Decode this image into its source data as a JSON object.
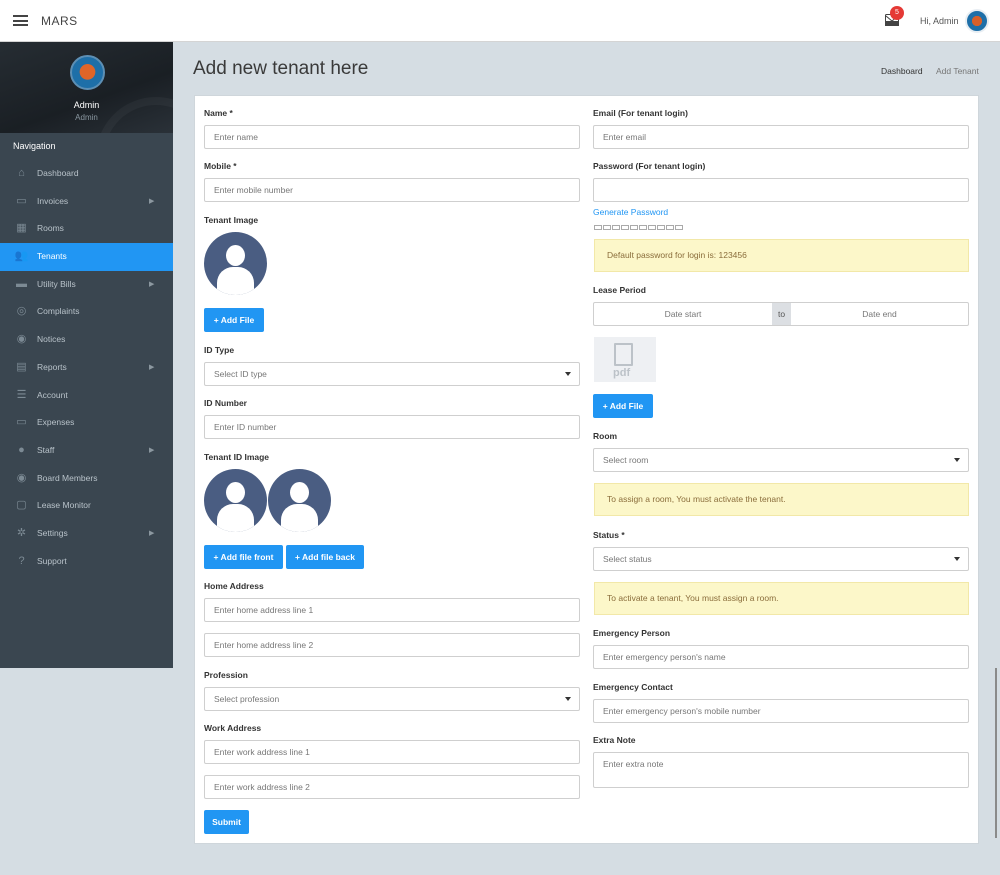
{
  "topbar": {
    "brand": "MARS",
    "mail_count": "5",
    "greeting": "Hi, Admin"
  },
  "sidebar": {
    "profile_name": "Admin",
    "profile_role": "Admin",
    "nav_heading": "Navigation",
    "items": [
      {
        "label": "Dashboard",
        "icon": "home-icon",
        "glyph": "⌂"
      },
      {
        "label": "Invoices",
        "icon": "invoice-icon",
        "glyph": "▭",
        "submenu": true
      },
      {
        "label": "Rooms",
        "icon": "rooms-icon",
        "glyph": "▦"
      },
      {
        "label": "Tenants",
        "icon": "users-icon",
        "glyph": "👥",
        "active": true
      },
      {
        "label": "Utility Bills",
        "icon": "bill-icon",
        "glyph": "▬",
        "submenu": true
      },
      {
        "label": "Complaints",
        "icon": "lifebuoy-icon",
        "glyph": "◎"
      },
      {
        "label": "Notices",
        "icon": "bullhorn-icon",
        "glyph": "◉"
      },
      {
        "label": "Reports",
        "icon": "report-icon",
        "glyph": "▤",
        "submenu": true
      },
      {
        "label": "Account",
        "icon": "list-icon",
        "glyph": "☰"
      },
      {
        "label": "Expenses",
        "icon": "card-icon",
        "glyph": "▭"
      },
      {
        "label": "Staff",
        "icon": "user-icon",
        "glyph": "●",
        "submenu": true
      },
      {
        "label": "Board Members",
        "icon": "user-circle-icon",
        "glyph": "◉"
      },
      {
        "label": "Lease Monitor",
        "icon": "monitor-icon",
        "glyph": "▢"
      },
      {
        "label": "Settings",
        "icon": "gear-icon",
        "glyph": "✲",
        "submenu": true
      },
      {
        "label": "Support",
        "icon": "question-icon",
        "glyph": "?"
      }
    ]
  },
  "page": {
    "title": "Add new tenant here",
    "breadcrumb": [
      "Dashboard",
      "Add Tenant"
    ]
  },
  "form": {
    "name_label": "Name *",
    "name_placeholder": "Enter name",
    "mobile_label": "Mobile *",
    "mobile_placeholder": "Enter mobile number",
    "tenant_image_label": "Tenant Image",
    "add_file": "+ Add File",
    "id_type_label": "ID Type",
    "id_type_value": "Select ID type",
    "id_number_label": "ID Number",
    "id_number_placeholder": "Enter ID number",
    "tenant_id_image_label": "Tenant ID Image",
    "add_file_front": "+ Add file front",
    "add_file_back": "+ Add file back",
    "home_address_label": "Home Address",
    "home_line1": "Enter home address line 1",
    "home_line2": "Enter home address line 2",
    "profession_label": "Profession",
    "profession_value": "Select profession",
    "work_address_label": "Work Address",
    "work_line1": "Enter work address line 1",
    "work_line2": "Enter work address line 2",
    "submit": "Submit",
    "email_label": "Email (For tenant login)",
    "email_placeholder": "Enter email",
    "password_label": "Password (For tenant login)",
    "password_placeholder": "",
    "generate_password": "Generate Password",
    "default_password_note": "Default password for login is: 123456",
    "lease_period_label": "Lease Period",
    "date_start": "Date start",
    "date_to": "to",
    "date_end": "Date end",
    "pdf_text": "pdf",
    "room_label": "Room",
    "room_value": "Select room",
    "room_note": "To assign a room, You must activate the tenant.",
    "status_label": "Status *",
    "status_value": "Select status",
    "status_note": "To activate a tenant, You must assign a room.",
    "emergency_person_label": "Emergency Person",
    "emergency_person_placeholder": "Enter emergency person's name",
    "emergency_contact_label": "Emergency Contact",
    "emergency_contact_placeholder": "Enter emergency person's mobile number",
    "extra_note_label": "Extra Note",
    "extra_note_placeholder": "Enter extra note"
  },
  "colors": {
    "accent": "#2196f3",
    "sidebar": "#3a4650",
    "alert_bg": "#fcf7c9",
    "badge": "#e53935"
  }
}
